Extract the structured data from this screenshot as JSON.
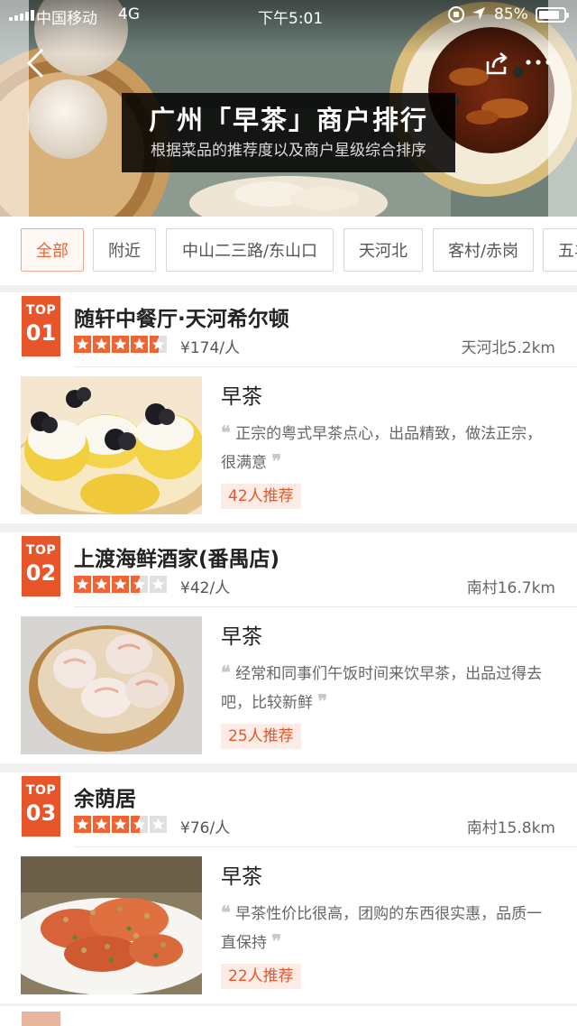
{
  "status_bar": {
    "carrier": "中国移动",
    "network": "4G",
    "time": "下午5:01",
    "battery_pct": "85%",
    "battery_level": 0.85
  },
  "banner": {
    "title": "广州「早茶」商户排行",
    "subtitle": "根据菜品的推荐度以及商户星级综合排序"
  },
  "filters": [
    {
      "label": "全部",
      "active": true
    },
    {
      "label": "附近",
      "active": false
    },
    {
      "label": "中山二三路/东山口",
      "active": false
    },
    {
      "label": "天河北",
      "active": false
    },
    {
      "label": "客村/赤岗",
      "active": false
    },
    {
      "label": "五羊",
      "active": false
    }
  ],
  "shops": [
    {
      "rank_top": "TOP",
      "rank_num": "01",
      "name": "随轩中餐厅·天河希尔顿",
      "rating": 4.5,
      "price": "¥174/人",
      "distance": "天河北5.2km",
      "dish": "早茶",
      "review": "正宗的粤式早茶点心，出品精致，做法正宗，很满意",
      "recommend": "42人推荐"
    },
    {
      "rank_top": "TOP",
      "rank_num": "02",
      "name": "上渡海鲜酒家(番禺店)",
      "rating": 3.5,
      "price": "¥42/人",
      "distance": "南村16.7km",
      "dish": "早茶",
      "review": "经常和同事们午饭时间来饮早茶，出品过得去吧，比较新鲜",
      "recommend": "25人推荐"
    },
    {
      "rank_top": "TOP",
      "rank_num": "03",
      "name": "余荫居",
      "rating": 3.5,
      "price": "¥76/人",
      "distance": "南村15.8km",
      "dish": "早茶",
      "review": "早茶性价比很高，团购的东西很实惠，品质一直保持",
      "recommend": "22人推荐"
    }
  ],
  "icons": {
    "back": "chevron-left-icon",
    "share": "share-icon",
    "more": "more-icon",
    "location": "location-arrow-icon",
    "rotation_lock": "rotation-lock-icon"
  },
  "colors": {
    "accent": "#f06433",
    "rank_badge": "#e7562b",
    "recommend_bg": "#fdece6"
  }
}
